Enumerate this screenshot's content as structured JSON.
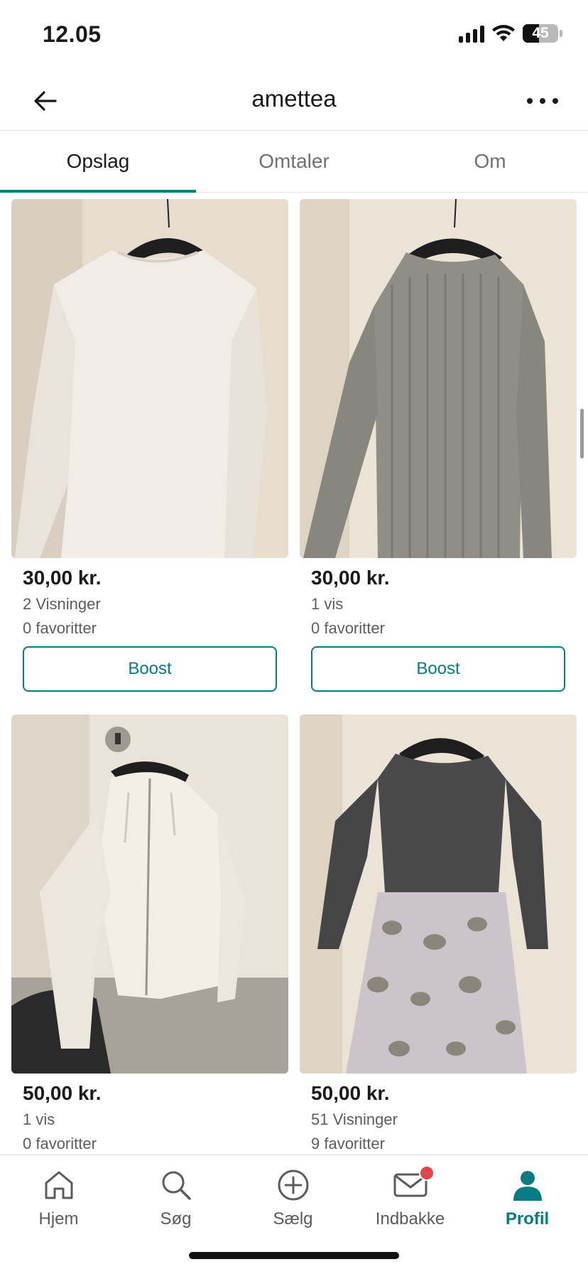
{
  "status_bar": {
    "time": "12.05",
    "battery": "45",
    "battery_level": 0.45
  },
  "header": {
    "title": "amettea",
    "back_icon": "arrow-left-icon",
    "more_icon": "more-horizontal-icon"
  },
  "tabs": [
    {
      "label": "Opslag",
      "active": true
    },
    {
      "label": "Omtaler",
      "active": false
    },
    {
      "label": "Om",
      "active": false
    }
  ],
  "listings": [
    {
      "price": "30,00 kr.",
      "views": "2 Visninger",
      "favorites": "0 favoritter",
      "boost_label": "Boost"
    },
    {
      "price": "30,00 kr.",
      "views": "1 vis",
      "favorites": "0 favoritter",
      "boost_label": "Boost"
    },
    {
      "price": "50,00 kr.",
      "views": "1 vis",
      "favorites": "0 favoritter"
    },
    {
      "price": "50,00 kr.",
      "views": "51 Visninger",
      "favorites": "9 favoritter"
    }
  ],
  "bottom_nav": [
    {
      "label": "Hjem",
      "icon": "home-icon"
    },
    {
      "label": "Søg",
      "icon": "search-icon"
    },
    {
      "label": "Sælg",
      "icon": "plus-circle-icon"
    },
    {
      "label": "Indbakke",
      "icon": "mail-icon",
      "badge": true
    },
    {
      "label": "Profil",
      "icon": "profile-icon",
      "active": true
    }
  ],
  "colors": {
    "accent": "#0a7a85",
    "badge": "#e0474c",
    "text": "#1a1a1a",
    "muted": "#5d5d5d"
  }
}
